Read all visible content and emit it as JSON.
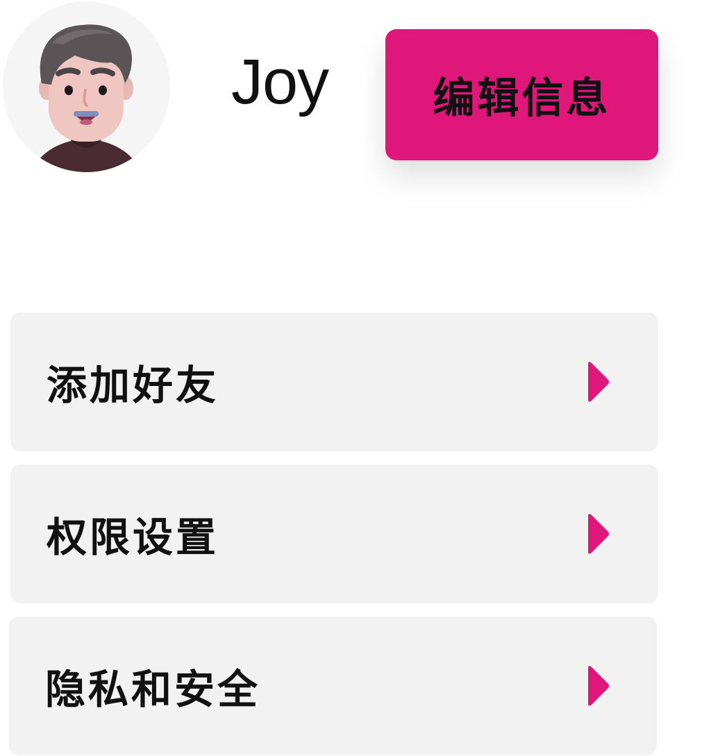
{
  "profile": {
    "username": "Joy",
    "edit_button_label": "编辑信息"
  },
  "menu": {
    "items": [
      {
        "label": "添加好友",
        "icon": "chevron-right-icon"
      },
      {
        "label": "权限设置",
        "icon": "chevron-right-icon"
      },
      {
        "label": "隐私和安全",
        "icon": "chevron-right-icon"
      }
    ]
  },
  "colors": {
    "accent": "#e0177a",
    "card_background": "#f2f2f2",
    "text": "#111111"
  }
}
